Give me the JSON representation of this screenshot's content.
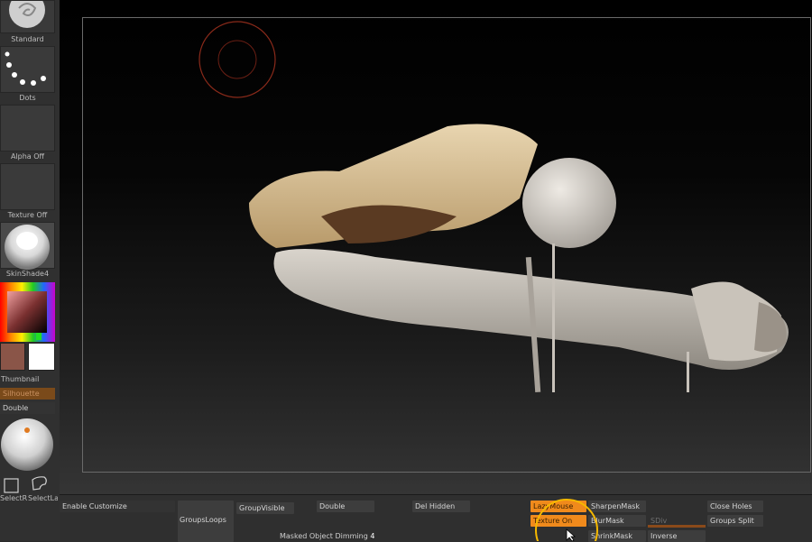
{
  "left_tray": {
    "brush_label": "Standard",
    "stroke_label": "Dots",
    "alpha_label": "Alpha Off",
    "texture_label": "Texture Off",
    "material_label": "SkinShade4",
    "thumbnail_label": "Thumbnail",
    "silhouette_label": "Silhouette",
    "double_label": "Double",
    "select_rect_label": "SelectRe",
    "select_lasso_label": "SelectLa"
  },
  "colors": {
    "main_color": "#8a5548",
    "secondary_color": "#ffffff",
    "accent_orange": "#f08a1c",
    "cursor_ring": "#f5b800"
  },
  "palette": {
    "enable_customize": "Enable Customize",
    "group_loops": "GroupsLoops",
    "group_visible": "GroupVisible",
    "double": "Double",
    "masked_dimming_label": "Masked Object Dimming",
    "masked_dimming_value": "4",
    "del_hidden": "Del Hidden",
    "lazy_mouse": "LazyMouse",
    "texture_on": "Texture On",
    "sharpen_mask": "SharpenMask",
    "blur_mask": "BlurMask",
    "shrink_mask": "ShrinkMask",
    "sdiv": "SDiv",
    "inverse": "Inverse",
    "close_holes": "Close Holes",
    "groups_split": "Groups Split"
  }
}
